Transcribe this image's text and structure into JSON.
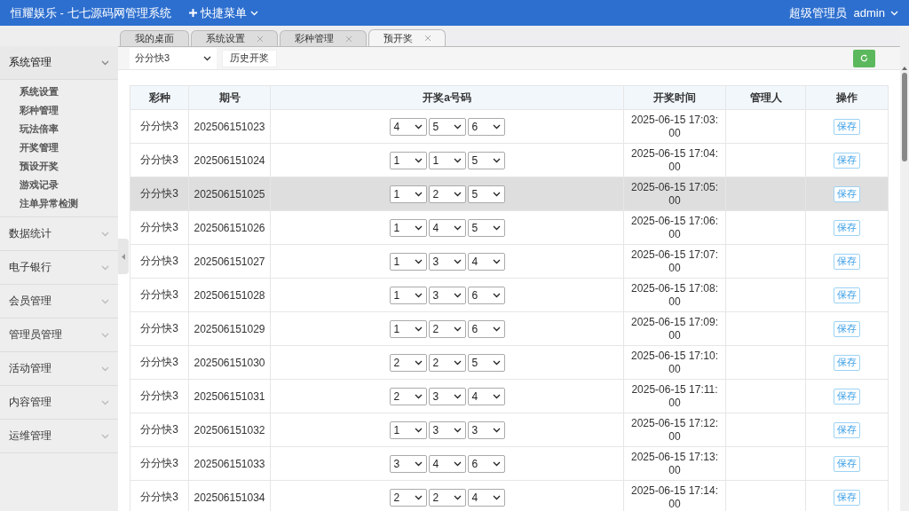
{
  "topbar": {
    "title": "恒耀娱乐 - 七七源码网管理系统",
    "quick_menu": "快捷菜单",
    "user_role": "超级管理员",
    "user_name": "admin"
  },
  "sidebar": {
    "items": [
      {
        "label": "系统管理",
        "expanded": true,
        "children": [
          {
            "label": "系统设置"
          },
          {
            "label": "彩种管理"
          },
          {
            "label": "玩法倍率"
          },
          {
            "label": "开奖管理"
          },
          {
            "label": "预设开奖"
          },
          {
            "label": "游戏记录"
          },
          {
            "label": "注单异常检测"
          }
        ]
      },
      {
        "label": "数据统计",
        "expanded": false
      },
      {
        "label": "电子银行",
        "expanded": false
      },
      {
        "label": "会员管理",
        "expanded": false
      },
      {
        "label": "管理员管理",
        "expanded": false
      },
      {
        "label": "活动管理",
        "expanded": false
      },
      {
        "label": "内容管理",
        "expanded": false
      },
      {
        "label": "运维管理",
        "expanded": false
      }
    ]
  },
  "tabs": [
    {
      "label": "我的桌面",
      "selected": false,
      "closable": false
    },
    {
      "label": "系统设置",
      "selected": false,
      "closable": true
    },
    {
      "label": "彩种管理",
      "selected": false,
      "closable": true
    },
    {
      "label": "预开奖",
      "selected": true,
      "closable": true
    }
  ],
  "toolbar": {
    "lottery_select": "分分快3",
    "history_button": "历史开奖"
  },
  "table": {
    "columns": [
      "彩种",
      "期号",
      "开奖a号码",
      "开奖时间",
      "管理人",
      "操作"
    ],
    "rows": [
      {
        "lottery": "分分快3",
        "issue": "202506151023",
        "numbers": [
          "4",
          "5",
          "6"
        ],
        "draw_time": "2025-06-15 17:03:00",
        "action": "保存",
        "selected": false
      },
      {
        "lottery": "分分快3",
        "issue": "202506151024",
        "numbers": [
          "1",
          "1",
          "5"
        ],
        "draw_time": "2025-06-15 17:04:00",
        "action": "保存",
        "selected": false
      },
      {
        "lottery": "分分快3",
        "issue": "202506151025",
        "numbers": [
          "1",
          "2",
          "5"
        ],
        "draw_time": "2025-06-15 17:05:00",
        "action": "保存",
        "selected": true
      },
      {
        "lottery": "分分快3",
        "issue": "202506151026",
        "numbers": [
          "1",
          "4",
          "5"
        ],
        "draw_time": "2025-06-15 17:06:00",
        "action": "保存",
        "selected": false
      },
      {
        "lottery": "分分快3",
        "issue": "202506151027",
        "numbers": [
          "1",
          "3",
          "4"
        ],
        "draw_time": "2025-06-15 17:07:00",
        "action": "保存",
        "selected": false
      },
      {
        "lottery": "分分快3",
        "issue": "202506151028",
        "numbers": [
          "1",
          "3",
          "6"
        ],
        "draw_time": "2025-06-15 17:08:00",
        "action": "保存",
        "selected": false
      },
      {
        "lottery": "分分快3",
        "issue": "202506151029",
        "numbers": [
          "1",
          "2",
          "6"
        ],
        "draw_time": "2025-06-15 17:09:00",
        "action": "保存",
        "selected": false
      },
      {
        "lottery": "分分快3",
        "issue": "202506151030",
        "numbers": [
          "2",
          "2",
          "5"
        ],
        "draw_time": "2025-06-15 17:10:00",
        "action": "保存",
        "selected": false
      },
      {
        "lottery": "分分快3",
        "issue": "202506151031",
        "numbers": [
          "2",
          "3",
          "4"
        ],
        "draw_time": "2025-06-15 17:11:00",
        "action": "保存",
        "selected": false
      },
      {
        "lottery": "分分快3",
        "issue": "202506151032",
        "numbers": [
          "1",
          "3",
          "3"
        ],
        "draw_time": "2025-06-15 17:12:00",
        "action": "保存",
        "selected": false
      },
      {
        "lottery": "分分快3",
        "issue": "202506151033",
        "numbers": [
          "3",
          "4",
          "6"
        ],
        "draw_time": "2025-06-15 17:13:00",
        "action": "保存",
        "selected": false
      },
      {
        "lottery": "分分快3",
        "issue": "202506151034",
        "numbers": [
          "2",
          "2",
          "4"
        ],
        "draw_time": "2025-06-15 17:14:00",
        "action": "保存",
        "selected": false
      }
    ]
  }
}
